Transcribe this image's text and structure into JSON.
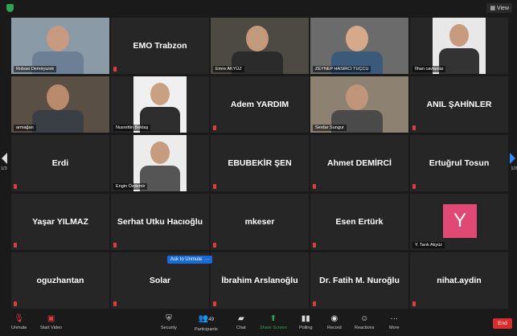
{
  "window": {
    "view_label": "View"
  },
  "participants": [
    {
      "name": "Rıdvan Demiryurek",
      "kind": "video"
    },
    {
      "name": "EMO Trabzon",
      "kind": "text"
    },
    {
      "name": "Emre AKYÜZ",
      "kind": "video"
    },
    {
      "name": "ZEYNEP HASIRCI TUÇCU",
      "kind": "video"
    },
    {
      "name": "İlhan cavlanlar",
      "kind": "photo"
    },
    {
      "name": "armağan",
      "kind": "video"
    },
    {
      "name": "Nusrettin Bektaş",
      "kind": "photo"
    },
    {
      "name": "Adem YARDIM",
      "kind": "text"
    },
    {
      "name": "Serdar Sungur",
      "kind": "video"
    },
    {
      "name": "ANIL ŞAHİNLER",
      "kind": "text"
    },
    {
      "name": "Erdi",
      "kind": "text"
    },
    {
      "name": "Engin Özdemir",
      "kind": "photo"
    },
    {
      "name": "EBUBEKİR ŞEN",
      "kind": "text"
    },
    {
      "name": "Ahmet DEMİRCİ",
      "kind": "text"
    },
    {
      "name": "Ertuğrul Tosun",
      "kind": "text"
    },
    {
      "name": "Yaşar YILMAZ",
      "kind": "text"
    },
    {
      "name": "Serhat Utku Hacıoğlu",
      "kind": "text"
    },
    {
      "name": "mkeser",
      "kind": "text"
    },
    {
      "name": "Esen Ertürk",
      "kind": "text"
    },
    {
      "name": "Y. Tarık Akyüz",
      "kind": "avatar",
      "avatar_letter": "Y"
    },
    {
      "name": "oguzhantan",
      "kind": "text"
    },
    {
      "name": "Solar",
      "kind": "text"
    },
    {
      "name": "İbrahim Arslanoğlu",
      "kind": "text"
    },
    {
      "name": "Dr. Fatih M. Nuroğlu",
      "kind": "text"
    },
    {
      "name": "nihat.aydin",
      "kind": "text"
    }
  ],
  "ask_to_unmute": {
    "label": "Ask to Unmute",
    "more": "···"
  },
  "pagination": {
    "left": "1/3",
    "right": "1/3"
  },
  "toolbar": {
    "unmute": "Unmute",
    "start_video": "Start Video",
    "security": "Security",
    "participants": "Participants",
    "participants_count": "49",
    "chat": "Chat",
    "share_screen": "Share Screen",
    "polling": "Polling",
    "record": "Record",
    "reactions": "Reactions",
    "more": "More",
    "end": "End"
  },
  "colors": {
    "active_speaker": "#8ee36b",
    "avatar_bg": "#e04974",
    "share": "#2ea44f",
    "end": "#d92d2d"
  }
}
